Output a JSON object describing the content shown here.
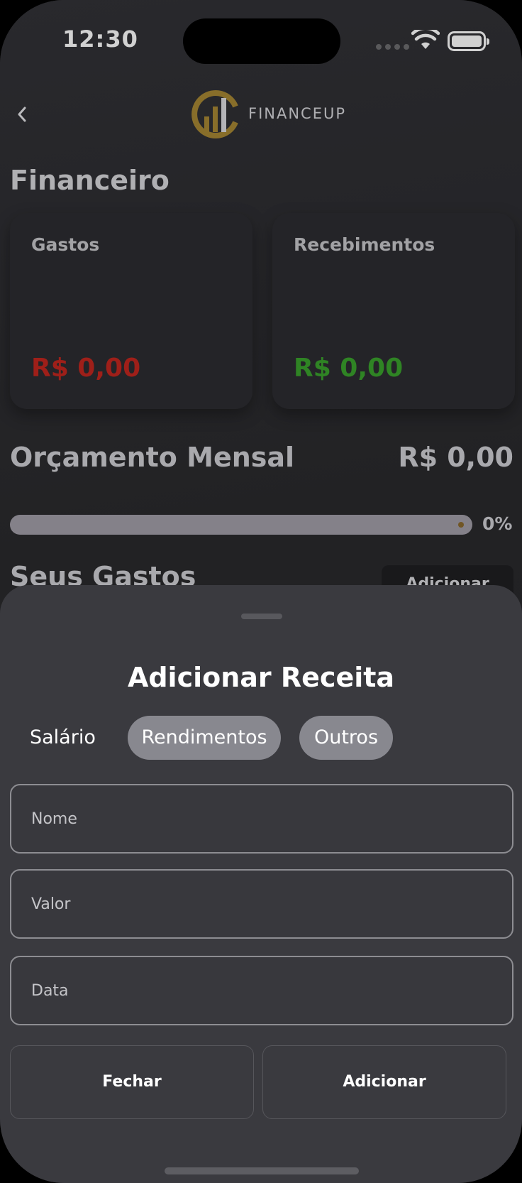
{
  "status": {
    "time": "12:30"
  },
  "header": {
    "brand": "FINANCEUP"
  },
  "page": {
    "title": "Financeiro"
  },
  "cards": [
    {
      "label": "Gastos",
      "value": "R$ 0,00",
      "color": "#c2271f"
    },
    {
      "label": "Recebimentos",
      "value": "R$ 0,00",
      "color": "#3aa12c"
    }
  ],
  "budget": {
    "title": "Orçamento Mensal",
    "value": "R$ 0,00",
    "percent_label": "0%",
    "progress": 0
  },
  "spending": {
    "title": "Seus Gastos",
    "add_label": "Adicionar"
  },
  "sheet": {
    "title": "Adicionar Receita",
    "categories": [
      "Salário",
      "Rendimentos",
      "Outros"
    ],
    "fields": {
      "name_placeholder": "Nome",
      "value_placeholder": "Valor",
      "date_placeholder": "Data"
    },
    "close_label": "Fechar",
    "add_label": "Adicionar"
  },
  "colors": {
    "accent_gold": "#a78734",
    "sheet_bg": "#3a3a3f"
  }
}
